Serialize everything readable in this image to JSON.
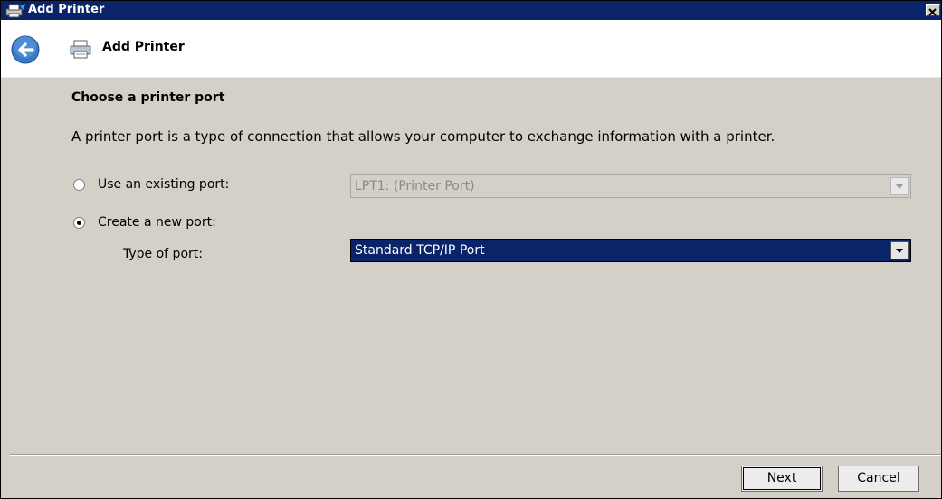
{
  "window": {
    "title": "Add Printer"
  },
  "header": {
    "title": "Add Printer"
  },
  "page": {
    "heading": "Choose a printer port",
    "description": "A printer port is a type of connection that allows your computer to exchange information with a printer."
  },
  "options": {
    "existing": {
      "label": "Use an existing port:",
      "selected": false,
      "value": "LPT1: (Printer Port)"
    },
    "new": {
      "label": "Create a new port:",
      "selected": true
    },
    "type_label": "Type of port:",
    "type_value": "Standard TCP/IP Port"
  },
  "buttons": {
    "next": "Next",
    "cancel": "Cancel"
  },
  "icons": {
    "title": "printer-icon",
    "back": "back-arrow-icon",
    "header": "printer-icon",
    "close": "close-icon",
    "dropdown": "chevron-down-icon"
  },
  "colors": {
    "titlebar": "#0a246a",
    "selection": "#0a246a",
    "face": "#d4d0c8",
    "back_button": "#3a78c8"
  }
}
